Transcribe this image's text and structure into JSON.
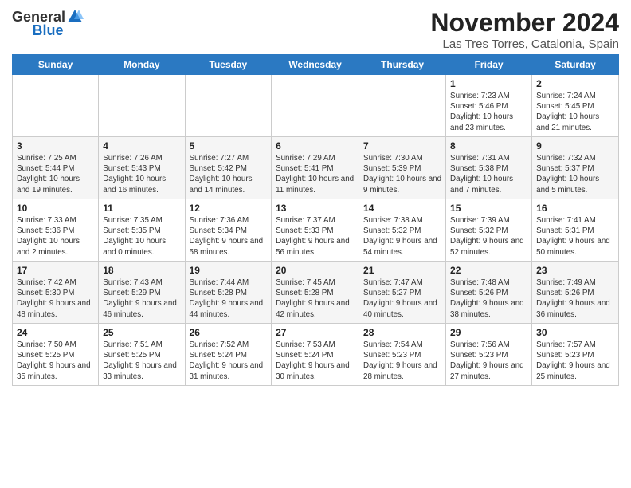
{
  "header": {
    "logo_general": "General",
    "logo_blue": "Blue",
    "title": "November 2024",
    "location": "Las Tres Torres, Catalonia, Spain"
  },
  "days_of_week": [
    "Sunday",
    "Monday",
    "Tuesday",
    "Wednesday",
    "Thursday",
    "Friday",
    "Saturday"
  ],
  "weeks": [
    [
      {
        "day": "",
        "info": ""
      },
      {
        "day": "",
        "info": ""
      },
      {
        "day": "",
        "info": ""
      },
      {
        "day": "",
        "info": ""
      },
      {
        "day": "",
        "info": ""
      },
      {
        "day": "1",
        "info": "Sunrise: 7:23 AM\nSunset: 5:46 PM\nDaylight: 10 hours and 23 minutes."
      },
      {
        "day": "2",
        "info": "Sunrise: 7:24 AM\nSunset: 5:45 PM\nDaylight: 10 hours and 21 minutes."
      }
    ],
    [
      {
        "day": "3",
        "info": "Sunrise: 7:25 AM\nSunset: 5:44 PM\nDaylight: 10 hours and 19 minutes."
      },
      {
        "day": "4",
        "info": "Sunrise: 7:26 AM\nSunset: 5:43 PM\nDaylight: 10 hours and 16 minutes."
      },
      {
        "day": "5",
        "info": "Sunrise: 7:27 AM\nSunset: 5:42 PM\nDaylight: 10 hours and 14 minutes."
      },
      {
        "day": "6",
        "info": "Sunrise: 7:29 AM\nSunset: 5:41 PM\nDaylight: 10 hours and 11 minutes."
      },
      {
        "day": "7",
        "info": "Sunrise: 7:30 AM\nSunset: 5:39 PM\nDaylight: 10 hours and 9 minutes."
      },
      {
        "day": "8",
        "info": "Sunrise: 7:31 AM\nSunset: 5:38 PM\nDaylight: 10 hours and 7 minutes."
      },
      {
        "day": "9",
        "info": "Sunrise: 7:32 AM\nSunset: 5:37 PM\nDaylight: 10 hours and 5 minutes."
      }
    ],
    [
      {
        "day": "10",
        "info": "Sunrise: 7:33 AM\nSunset: 5:36 PM\nDaylight: 10 hours and 2 minutes."
      },
      {
        "day": "11",
        "info": "Sunrise: 7:35 AM\nSunset: 5:35 PM\nDaylight: 10 hours and 0 minutes."
      },
      {
        "day": "12",
        "info": "Sunrise: 7:36 AM\nSunset: 5:34 PM\nDaylight: 9 hours and 58 minutes."
      },
      {
        "day": "13",
        "info": "Sunrise: 7:37 AM\nSunset: 5:33 PM\nDaylight: 9 hours and 56 minutes."
      },
      {
        "day": "14",
        "info": "Sunrise: 7:38 AM\nSunset: 5:32 PM\nDaylight: 9 hours and 54 minutes."
      },
      {
        "day": "15",
        "info": "Sunrise: 7:39 AM\nSunset: 5:32 PM\nDaylight: 9 hours and 52 minutes."
      },
      {
        "day": "16",
        "info": "Sunrise: 7:41 AM\nSunset: 5:31 PM\nDaylight: 9 hours and 50 minutes."
      }
    ],
    [
      {
        "day": "17",
        "info": "Sunrise: 7:42 AM\nSunset: 5:30 PM\nDaylight: 9 hours and 48 minutes."
      },
      {
        "day": "18",
        "info": "Sunrise: 7:43 AM\nSunset: 5:29 PM\nDaylight: 9 hours and 46 minutes."
      },
      {
        "day": "19",
        "info": "Sunrise: 7:44 AM\nSunset: 5:28 PM\nDaylight: 9 hours and 44 minutes."
      },
      {
        "day": "20",
        "info": "Sunrise: 7:45 AM\nSunset: 5:28 PM\nDaylight: 9 hours and 42 minutes."
      },
      {
        "day": "21",
        "info": "Sunrise: 7:47 AM\nSunset: 5:27 PM\nDaylight: 9 hours and 40 minutes."
      },
      {
        "day": "22",
        "info": "Sunrise: 7:48 AM\nSunset: 5:26 PM\nDaylight: 9 hours and 38 minutes."
      },
      {
        "day": "23",
        "info": "Sunrise: 7:49 AM\nSunset: 5:26 PM\nDaylight: 9 hours and 36 minutes."
      }
    ],
    [
      {
        "day": "24",
        "info": "Sunrise: 7:50 AM\nSunset: 5:25 PM\nDaylight: 9 hours and 35 minutes."
      },
      {
        "day": "25",
        "info": "Sunrise: 7:51 AM\nSunset: 5:25 PM\nDaylight: 9 hours and 33 minutes."
      },
      {
        "day": "26",
        "info": "Sunrise: 7:52 AM\nSunset: 5:24 PM\nDaylight: 9 hours and 31 minutes."
      },
      {
        "day": "27",
        "info": "Sunrise: 7:53 AM\nSunset: 5:24 PM\nDaylight: 9 hours and 30 minutes."
      },
      {
        "day": "28",
        "info": "Sunrise: 7:54 AM\nSunset: 5:23 PM\nDaylight: 9 hours and 28 minutes."
      },
      {
        "day": "29",
        "info": "Sunrise: 7:56 AM\nSunset: 5:23 PM\nDaylight: 9 hours and 27 minutes."
      },
      {
        "day": "30",
        "info": "Sunrise: 7:57 AM\nSunset: 5:23 PM\nDaylight: 9 hours and 25 minutes."
      }
    ]
  ]
}
